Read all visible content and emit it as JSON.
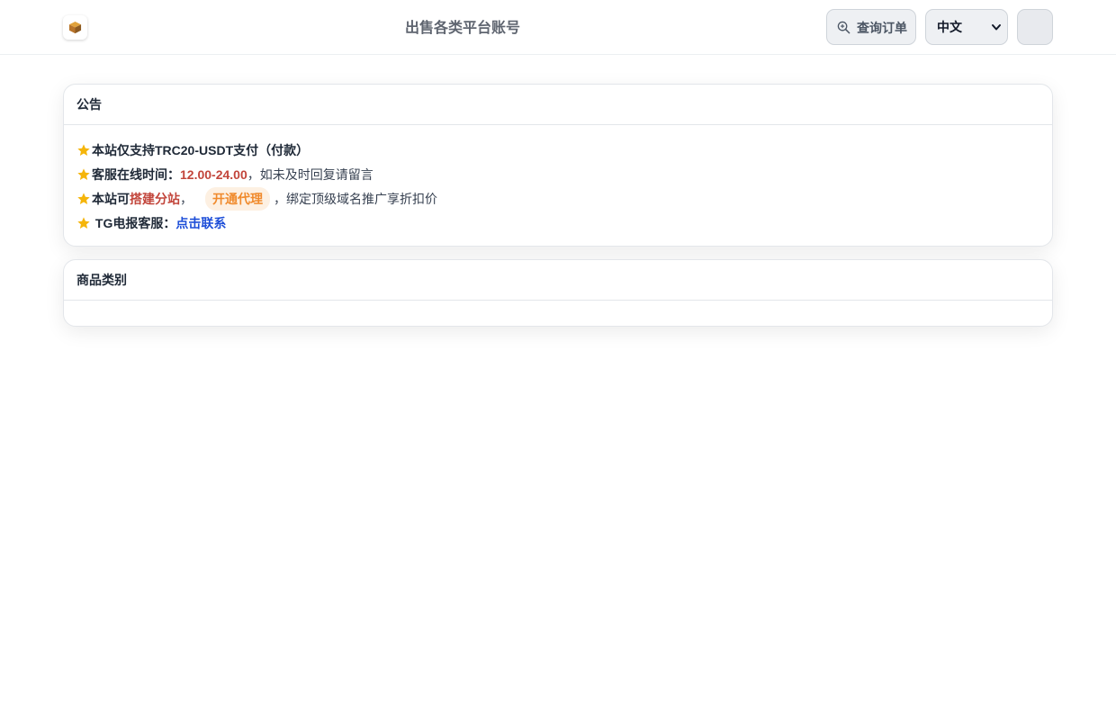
{
  "header": {
    "site_title": "出售各类平台账号",
    "query_order_label": "查询订单",
    "language_selected": "中文",
    "logo_icon": "box-logo-icon",
    "query_icon": "zoom-in-icon",
    "user_icon": "avatar-placeholder"
  },
  "notice": {
    "title": "公告",
    "line1_text": "本站仅支持TRC20-USDT支付（付款）",
    "line2_label": "客服在线时间：",
    "line2_hours": "12.00-24.00",
    "line2_suffix": "，如未及时回复请留言",
    "line3_prefix": "本站可",
    "line3_highlight": "搭建分站",
    "line3_comma": "，",
    "line3_pill": "开通代理",
    "line3_suffix": "，绑定顶级域名推广享折扣价",
    "line4_label": " TG电报客服：",
    "line4_link": "点击联系",
    "star_icon": "star-icon"
  },
  "categories": {
    "title": "商品类别"
  },
  "colors": {
    "accent_red": "#c2453b",
    "accent_orange": "#f08a2c",
    "link_blue": "#1d4ed8",
    "star_yellow": "#f5b50a"
  }
}
